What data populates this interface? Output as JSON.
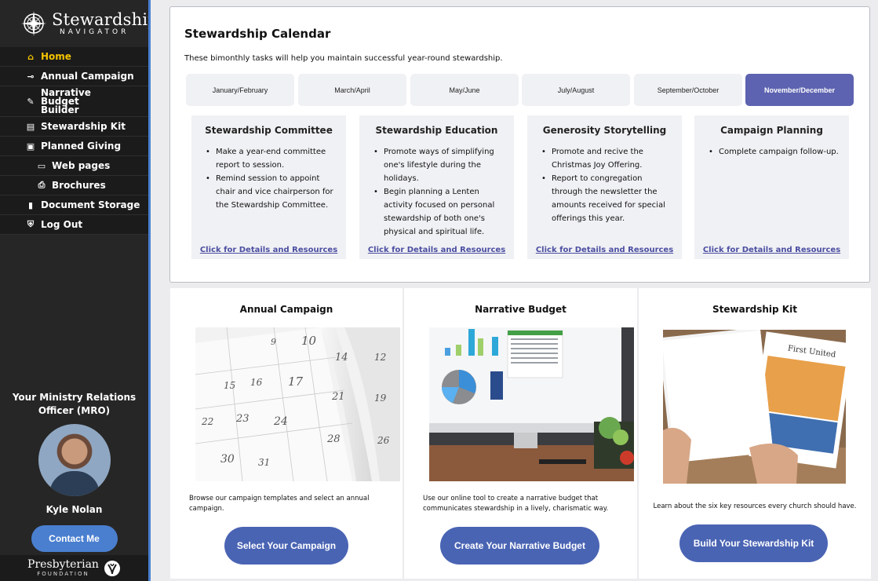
{
  "sidebar": {
    "logo_main": "Stewardship",
    "logo_sub": "NAVIGATOR",
    "nav": [
      {
        "label": "Home",
        "icon": "home-icon",
        "active": true
      },
      {
        "label": "Annual Campaign",
        "icon": "key-icon"
      },
      {
        "label": "Narrative Budget Builder",
        "icon": "pencil-icon"
      },
      {
        "label": "Stewardship Kit",
        "icon": "folder-icon"
      },
      {
        "label": "Planned Giving",
        "icon": "calendar-icon"
      },
      {
        "label": "Web pages",
        "icon": "window-icon"
      },
      {
        "label": "Brochures",
        "icon": "print-icon"
      },
      {
        "label": "Document Storage",
        "icon": "bookmark-icon"
      },
      {
        "label": "Log Out",
        "icon": "shield-icon"
      }
    ],
    "mro_title": "Your Ministry Relations Officer (MRO)",
    "mro_name": "Kyle Nolan",
    "contact_label": "Contact Me",
    "foundation_main": "Presbyterian",
    "foundation_sub": "FOUNDATION"
  },
  "calendar": {
    "title": "Stewardship Calendar",
    "description": "These bimonthly tasks will help you maintain successful year-round stewardship.",
    "tabs": [
      {
        "label": "January/February"
      },
      {
        "label": "March/April"
      },
      {
        "label": "May/June"
      },
      {
        "label": "July/August"
      },
      {
        "label": "September/October"
      },
      {
        "label": "November/December",
        "active": true
      }
    ],
    "cards": [
      {
        "title": "Stewardship Committee",
        "items": [
          "Make a year-end committee report to session.",
          "Remind session to appoint chair and vice chairperson for the Stewardship Committee."
        ],
        "link": "Click for Details and Resources"
      },
      {
        "title": "Stewardship Education",
        "items": [
          "Promote ways of simplifying one's lifestyle during the holidays.",
          "Begin planning a Lenten activity focused on personal stewardship of both one's physical and spiritual life."
        ],
        "link": "Click for Details and Resources"
      },
      {
        "title": "Generosity Storytelling",
        "items": [
          "Promote and recive the Christmas Joy Offering.",
          "Report to congregation through the newsletter the amounts received for special offerings this year."
        ],
        "link": "Click for Details and Resources"
      },
      {
        "title": "Campaign Planning",
        "items": [
          "Complete campaign follow-up."
        ],
        "link": "Click for Details and Resources"
      }
    ]
  },
  "features": [
    {
      "title": "Annual Campaign",
      "description": "Browse our campaign templates and select an annual campaign.",
      "button": "Select Your Campaign"
    },
    {
      "title": "Narrative Budget",
      "description": "Use our online tool to create a narrative budget that communicates stewardship in a lively, charismatic way.",
      "button": "Create Your Narrative Budget"
    },
    {
      "title": "Stewardship Kit",
      "description": "Learn about the six key resources every church should have.",
      "button": "Build Your Stewardship Kit"
    }
  ],
  "images": {
    "calendar_numbers": [
      "9",
      "10",
      "14",
      "12",
      "15",
      "16",
      "17",
      "21",
      "19",
      "22",
      "23",
      "24",
      "28",
      "26",
      "30",
      "31"
    ],
    "kit_booklet_title": "First United"
  },
  "colors": {
    "sidebar_bg": "#262626",
    "accent_yellow": "#f5c400",
    "accent_blue": "#4a7fd0",
    "tab_active": "#5d63b0",
    "button_blue": "#4a64b4",
    "link_purple": "#4b4ea1"
  }
}
